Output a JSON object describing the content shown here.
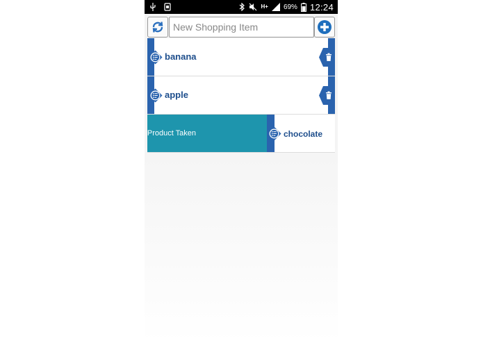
{
  "status_bar": {
    "battery_percent": "69%",
    "network": "H+",
    "time": "12:24"
  },
  "input": {
    "placeholder": "New Shopping Item",
    "value": ""
  },
  "items": [
    {
      "label": "banana"
    },
    {
      "label": "apple"
    }
  ],
  "taken_item": {
    "label": "chocolate",
    "action_label": "Product Taken"
  },
  "colors": {
    "accent_blue": "#2a63ae",
    "taken_teal": "#1e95ad",
    "label_blue": "#1e4e8c"
  },
  "icons": {
    "refresh": "refresh-icon",
    "add": "plus-circle-icon",
    "list": "list-badge-icon",
    "delete": "trash-icon"
  }
}
